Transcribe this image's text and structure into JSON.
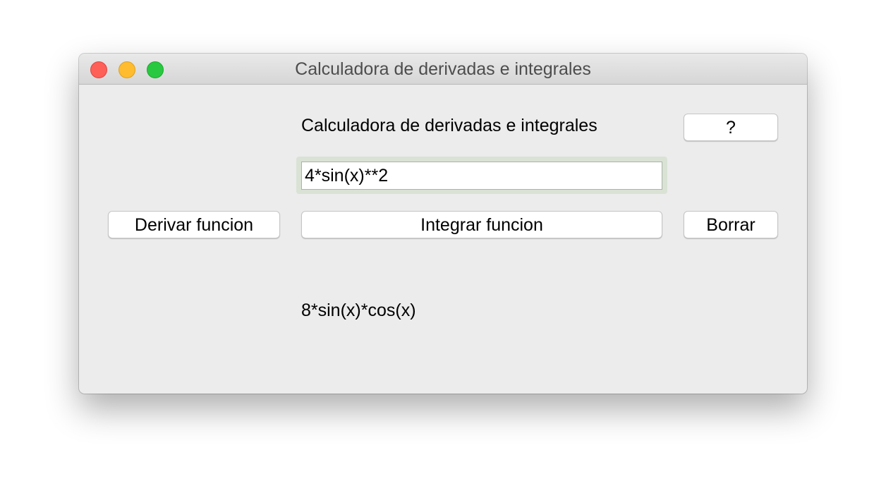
{
  "window": {
    "title": "Calculadora de derivadas e integrales"
  },
  "header": {
    "heading": "Calculadora de derivadas e integrales",
    "help_label": "?"
  },
  "input": {
    "value": "4*sin(x)**2"
  },
  "buttons": {
    "derive_label": "Derivar funcion",
    "integrate_label": "Integrar funcion",
    "clear_label": "Borrar"
  },
  "output": {
    "result": "8*sin(x)*cos(x)"
  },
  "colors": {
    "close": "#fe5f57",
    "minimize": "#febc2e",
    "maximize": "#28c840",
    "window_bg": "#ececec"
  }
}
